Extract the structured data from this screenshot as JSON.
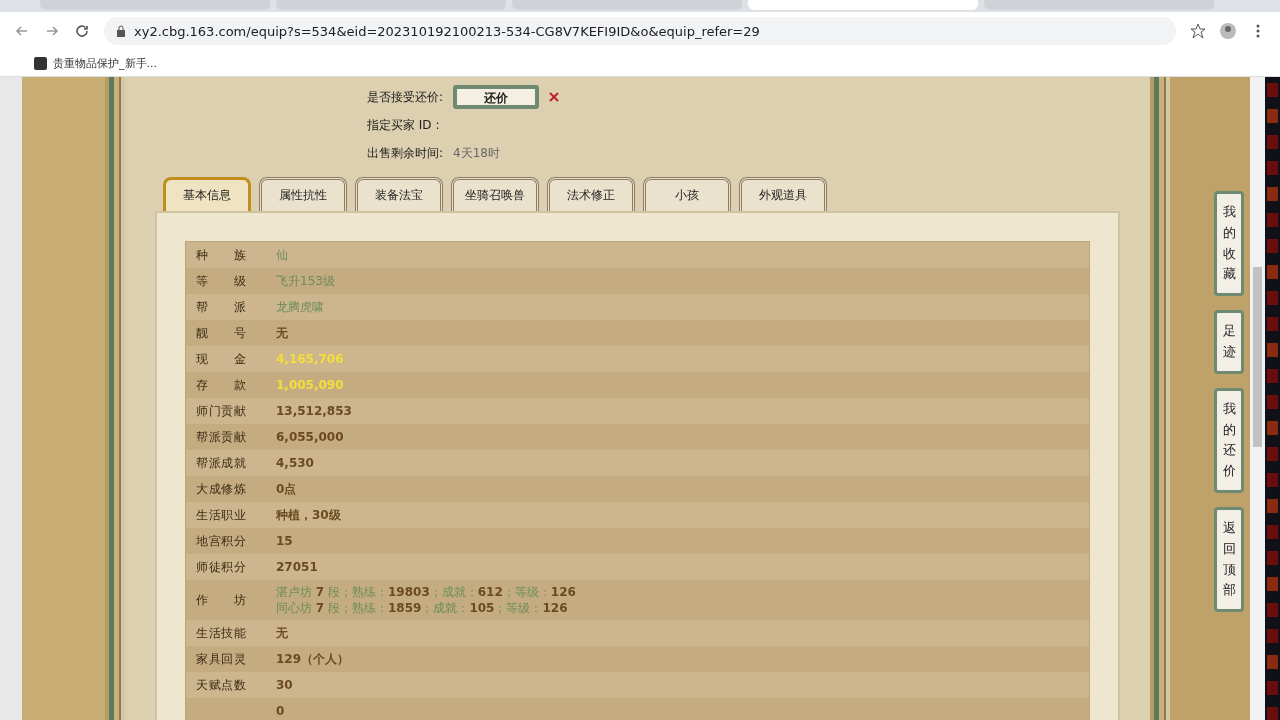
{
  "browser": {
    "tabs": [
      {
        "selected": false
      },
      {
        "selected": false
      },
      {
        "selected": false
      },
      {
        "selected": true
      },
      {
        "selected": false
      }
    ],
    "url": "xy2.cbg.163.com/equip?s=534&eid=202310192100213-534-CG8V7KEFI9ID&o&equip_refer=29",
    "bookmarks": [
      {
        "label": "贵重物品保护_新手..."
      }
    ]
  },
  "trade": [
    {
      "kind": "button",
      "label": "是否接受还价:",
      "button": "还价"
    },
    {
      "kind": "text",
      "label": "指定买家 ID :"
    },
    {
      "kind": "value",
      "label": "出售剩余时间:",
      "value": "4天18时"
    }
  ],
  "tabs": [
    {
      "label": "基本信息",
      "selected": true
    },
    {
      "label": "属性抗性",
      "selected": false
    },
    {
      "label": "装备法宝",
      "selected": false
    },
    {
      "label": "坐骑召唤兽",
      "selected": false
    },
    {
      "label": "法术修正",
      "selected": false
    },
    {
      "label": "小孩",
      "selected": false
    },
    {
      "label": "外观道具",
      "selected": false
    }
  ],
  "rows": [
    {
      "label": "种 族",
      "kind": "green",
      "value": "仙"
    },
    {
      "label": "等 级",
      "kind": "green",
      "value": "飞升153级"
    },
    {
      "label": "帮 派",
      "kind": "green",
      "value": "龙腾虎啸"
    },
    {
      "label": "靓 号",
      "kind": "plain",
      "value": "无"
    },
    {
      "label": "现 金",
      "kind": "gold",
      "value": "4,165,706"
    },
    {
      "label": "存 款",
      "kind": "gold",
      "value": "1,005,090"
    },
    {
      "label": "师门贡献",
      "kind": "plain",
      "value": "13,512,853"
    },
    {
      "label": "帮派贡献",
      "kind": "plain",
      "value": "6,055,000"
    },
    {
      "label": "帮派成就",
      "kind": "plain",
      "value": "4,530"
    },
    {
      "label": "大成修炼",
      "kind": "plain",
      "value": "0点"
    },
    {
      "label": "生活职业",
      "kind": "plain",
      "value": "种植，30级"
    },
    {
      "label": "地宫积分",
      "kind": "plain",
      "value": "15"
    },
    {
      "label": "师徒积分",
      "kind": "plain",
      "value": "27051"
    },
    {
      "label": "作 坊",
      "kind": "mixed",
      "lines": [
        "湛卢坊 **7** 段；熟练：**19803**；成就：**612**；等级：**126**",
        "同心坊 **7** 段；熟练：**1859**；成就：**105**；等级：**126**"
      ]
    },
    {
      "label": "生活技能",
      "kind": "plain",
      "value": "无"
    },
    {
      "label": "家具回灵",
      "kind": "plain",
      "value": "129（个人）"
    },
    {
      "label": "天赋点数",
      "kind": "plain",
      "value": "30"
    },
    {
      "kind": "plain",
      "value": "0"
    }
  ],
  "side_buttons": [
    {
      "label": "我的收藏"
    },
    {
      "label": "足迹"
    },
    {
      "label": "我的还价"
    },
    {
      "label": "返回顶部"
    }
  ]
}
